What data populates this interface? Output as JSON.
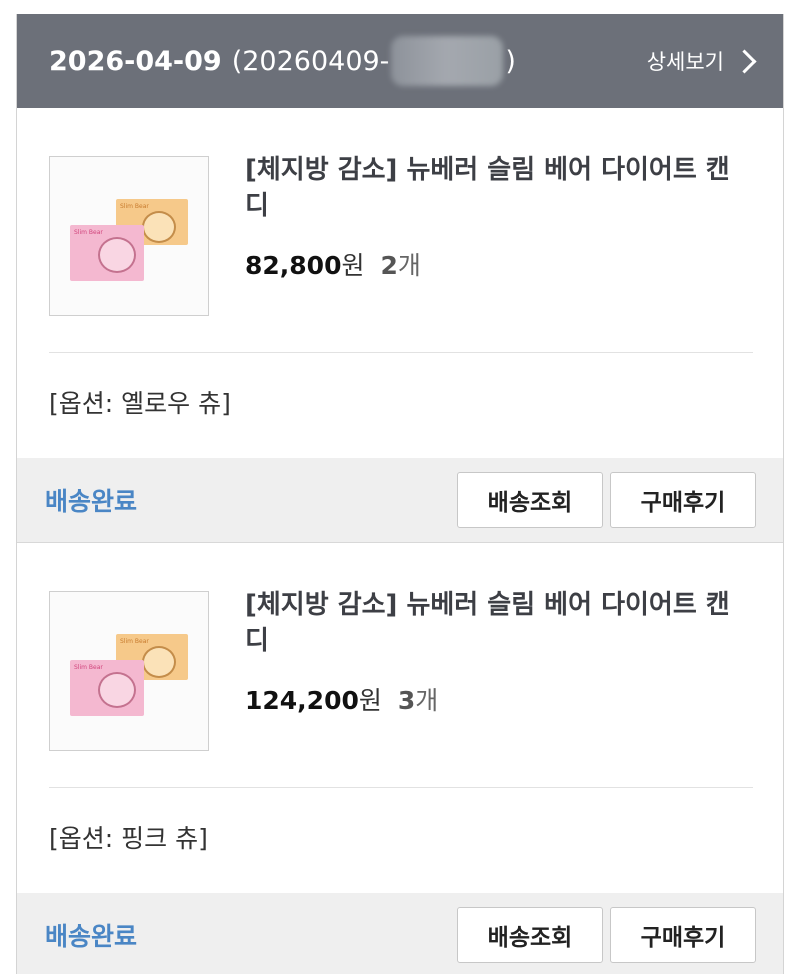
{
  "order": {
    "date": "2026-04-09",
    "number_prefix": "(20260409-",
    "number_suffix": ")",
    "detail_label": "상세보기"
  },
  "items": [
    {
      "title": "[체지방 감소] 뉴베러 슬림 베어 다이어트 캔디",
      "price": "82,800",
      "currency": "원",
      "quantity": "2",
      "quantity_unit": "개",
      "option": "[옵션: 옐로우 츄]",
      "status": "배송완료",
      "track_label": "배송조회",
      "review_label": "구매후기",
      "pkg_text": "Slim Bear"
    },
    {
      "title": "[체지방 감소] 뉴베러 슬림 베어 다이어트 캔디",
      "price": "124,200",
      "currency": "원",
      "quantity": "3",
      "quantity_unit": "개",
      "option": "[옵션: 핑크 츄]",
      "status": "배송완료",
      "track_label": "배송조회",
      "review_label": "구매후기",
      "pkg_text": "Slim Bear"
    }
  ],
  "colors": {
    "header_bg": "#6c7079",
    "status_blue": "#4a86c5",
    "status_bar_bg": "#efefef"
  },
  "icons": {
    "detail": "chevron-right-icon"
  }
}
